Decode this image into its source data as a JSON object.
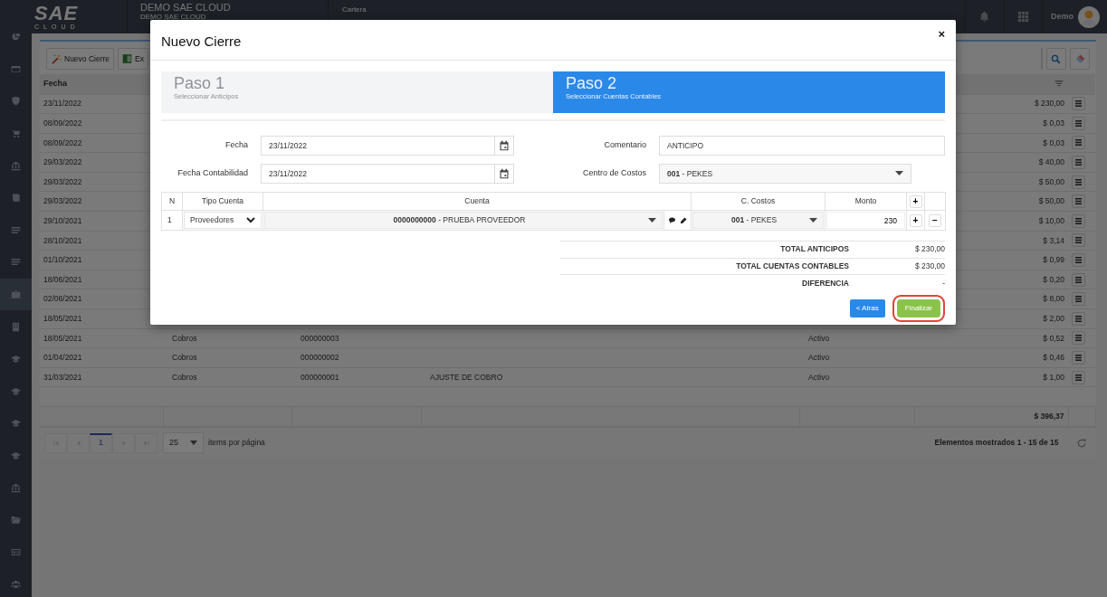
{
  "header": {
    "logo": "SAE",
    "logo_sub": "CLOUD",
    "company": "DEMO SAE CLOUD",
    "company_sub": "DEMO SAE CLOUD",
    "module": "Cartera",
    "user": "Demo"
  },
  "sidebar": {
    "items": [
      {
        "selected": false
      },
      {
        "selected": false
      },
      {
        "selected": false
      },
      {
        "selected": false
      },
      {
        "selected": false
      },
      {
        "selected": false
      },
      {
        "selected": false
      },
      {
        "selected": false
      },
      {
        "selected": true
      },
      {
        "selected": false
      },
      {
        "selected": false
      },
      {
        "selected": false
      },
      {
        "selected": false
      },
      {
        "selected": false
      },
      {
        "selected": false
      },
      {
        "selected": false
      },
      {
        "selected": false
      },
      {
        "selected": false
      }
    ]
  },
  "toolbar": {
    "buttons": [
      {
        "label": "Nuevo Cierre",
        "kind": "new"
      },
      {
        "label": "Ex",
        "kind": "export"
      }
    ]
  },
  "table": {
    "columns": [
      "Fecha"
    ],
    "rows": [
      {
        "fecha": "23/11/2022",
        "monto": "$ 230,00"
      },
      {
        "fecha": "08/09/2022",
        "monto": "$ 0,03"
      },
      {
        "fecha": "08/09/2022",
        "monto": "$ 0,03"
      },
      {
        "fecha": "29/03/2022",
        "monto": "$ 40,00"
      },
      {
        "fecha": "29/03/2022",
        "monto": "$ 50,00"
      },
      {
        "fecha": "29/03/2022",
        "monto": "$ 50,00"
      },
      {
        "fecha": "29/10/2021",
        "monto": "$ 10,00"
      },
      {
        "fecha": "28/10/2021",
        "monto": "$ 3,14"
      },
      {
        "fecha": "01/10/2021",
        "monto": "$ 0,99"
      },
      {
        "fecha": "18/06/2021",
        "monto": "$ 0,20"
      },
      {
        "fecha": "02/06/2021",
        "monto": "$ 8,00"
      },
      {
        "fecha": "18/05/2021",
        "monto": "$ 2,00"
      },
      {
        "fecha": "18/05/2021",
        "tipo": "Cobros",
        "numero": "000000003",
        "estado": "Activo",
        "monto": "$ 0,52"
      },
      {
        "fecha": "01/04/2021",
        "tipo": "Cobros",
        "numero": "000000002",
        "estado": "Activo",
        "monto": "$ 0,46"
      },
      {
        "fecha": "31/03/2021",
        "tipo": "Cobros",
        "numero": "000000001",
        "descripcion": "AJUSTE DE COBRO",
        "estado": "Activo",
        "monto": "$ 1,00"
      }
    ],
    "total": "$ 396,37"
  },
  "pagination": {
    "pages": [
      {
        "label": "1",
        "selected": true
      }
    ],
    "page_size": "25",
    "page_size_label": "items por página",
    "summary": "Elementos mostrados 1 - 15 de 15"
  },
  "modal": {
    "title": "Nuevo Cierre",
    "close": "×",
    "steps": [
      {
        "title": "Paso 1",
        "subtitle": "Seleccionar Anticipos",
        "selected": false
      },
      {
        "title": "Paso 2",
        "subtitle": "Seleccionar Cuentas Contables",
        "selected": true
      }
    ],
    "fields": [
      {
        "label": "Fecha",
        "value": "23/11/2022",
        "kind": "date"
      },
      {
        "label": "Comentario",
        "value": "ANTICIPO",
        "kind": "text"
      },
      {
        "label": "Fecha Contabilidad",
        "value": "23/11/2022",
        "kind": "date"
      },
      {
        "label": "Centro de Costos",
        "value": "**001** - PEKES",
        "kind": "select"
      }
    ],
    "grid": {
      "columns": [
        "N",
        "Tipo Cuenta",
        "Cuenta",
        "C. Costos",
        "Monto"
      ],
      "add": "+",
      "rows": [
        {
          "n": "1",
          "tipo": "Proveedores",
          "cuenta": "**0000000000** - PRUEBA PROVEEDOR",
          "costos": "**001** - PEKES",
          "monto": "230",
          "add": "+",
          "remove": "−"
        }
      ]
    },
    "totals": [
      {
        "label": "TOTAL ANTICIPOS",
        "value": "$ 230,00"
      },
      {
        "label": "TOTAL CUENTAS CONTABLES",
        "value": "$ 230,00"
      },
      {
        "label": "DIFERENCIA",
        "value": "-"
      }
    ],
    "buttons": [
      {
        "label": "< Atras",
        "kind": "back",
        "highlighted": false
      },
      {
        "label": "Finalizar",
        "kind": "finish",
        "highlighted": true
      }
    ]
  }
}
